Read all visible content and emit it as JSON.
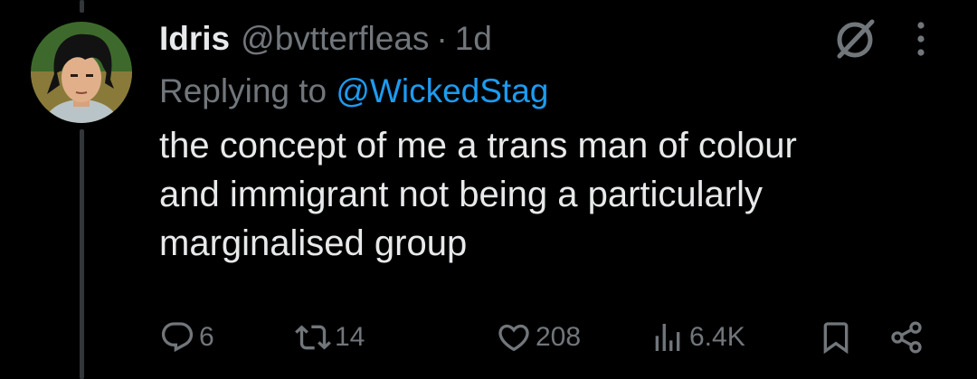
{
  "tweet": {
    "author": {
      "display_name": "Idris",
      "handle": "@bvtterfleas",
      "separator": "·",
      "time": "1d"
    },
    "replying_to": {
      "prefix": "Replying to",
      "mention": "@WickedStag"
    },
    "text_lines": [
      "the concept of me a trans man of colour",
      "and immigrant not being a particularly",
      "marginalised group"
    ],
    "stats": {
      "replies": "6",
      "retweets": "14",
      "likes": "208",
      "views": "6.4K"
    }
  },
  "icons": {
    "header": [
      "grok-icon",
      "more-icon"
    ],
    "actions": [
      "reply-icon",
      "retweet-icon",
      "like-icon",
      "views-icon",
      "bookmark-icon",
      "share-icon"
    ]
  },
  "colors": {
    "background": "#000000",
    "primary_text": "#e7e9ea",
    "secondary_text": "#71767b",
    "link": "#1d9bf0",
    "thread_line": "#333639"
  }
}
